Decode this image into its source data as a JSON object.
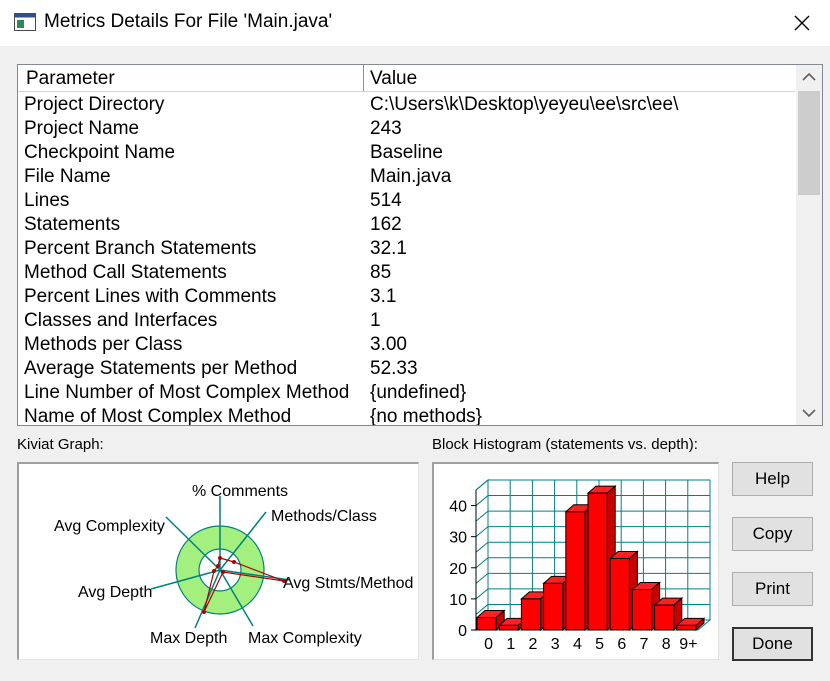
{
  "window": {
    "title": "Metrics Details For File 'Main.java'"
  },
  "table": {
    "columns": [
      "Parameter",
      "Value"
    ],
    "rows": [
      [
        "Project Directory",
        "C:\\Users\\k\\Desktop\\yeyeu\\ee\\src\\ee\\"
      ],
      [
        "Project Name",
        "243"
      ],
      [
        "Checkpoint Name",
        "Baseline"
      ],
      [
        "File Name",
        "Main.java"
      ],
      [
        "Lines",
        "514"
      ],
      [
        "Statements",
        "162"
      ],
      [
        "Percent Branch Statements",
        "32.1"
      ],
      [
        "Method Call Statements",
        "85"
      ],
      [
        "Percent Lines with Comments",
        "3.1"
      ],
      [
        "Classes and Interfaces",
        "1"
      ],
      [
        "Methods per Class",
        "3.00"
      ],
      [
        "Average Statements per Method",
        "52.33"
      ],
      [
        "Line Number of Most Complex Method",
        "{undefined}"
      ],
      [
        "Name of Most Complex Method",
        "{no methods}"
      ]
    ]
  },
  "kiviat": {
    "label": "Kiviat Graph:",
    "axes": {
      "comments": "% Comments",
      "methods_class": "Methods/Class",
      "avg_stmts": "Avg Stmts/Method",
      "max_complexity": "Max Complexity",
      "max_depth": "Max Depth",
      "avg_depth": "Avg Depth",
      "avg_complexity": "Avg Complexity"
    }
  },
  "histogram": {
    "label": "Block Histogram (statements vs. depth):",
    "chart_data": {
      "type": "bar",
      "categories": [
        "0",
        "1",
        "2",
        "3",
        "4",
        "5",
        "6",
        "7",
        "8",
        "9+"
      ],
      "values": [
        4,
        1,
        10,
        15,
        38,
        44,
        23,
        13,
        8,
        0
      ],
      "ylim": [
        0,
        45
      ],
      "yticks": [
        "0",
        "10",
        "20",
        "30",
        "40"
      ],
      "bar_color": "#ff0000",
      "grid_color": "#008080"
    }
  },
  "buttons": {
    "help": "Help",
    "copy": "Copy",
    "print": "Print",
    "done": "Done"
  }
}
